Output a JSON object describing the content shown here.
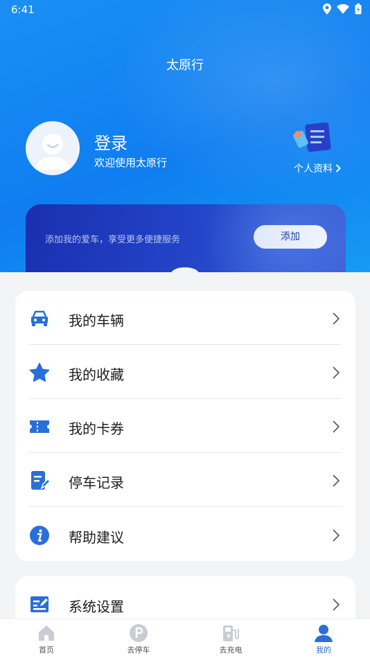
{
  "status_bar": {
    "time": "6:41"
  },
  "header": {
    "title": "太原行"
  },
  "user": {
    "login_label": "登录",
    "welcome": "欢迎使用太原行",
    "profile_link": "个人资料"
  },
  "car_card": {
    "hint": "添加我的爱车，享受更多便捷服务",
    "add_label": "添加"
  },
  "menu": [
    {
      "label": "我的车辆",
      "icon": "car-icon"
    },
    {
      "label": "我的收藏",
      "icon": "star-icon"
    },
    {
      "label": "我的卡券",
      "icon": "ticket-icon"
    },
    {
      "label": "停车记录",
      "icon": "record-icon"
    },
    {
      "label": "帮助建议",
      "icon": "info-icon"
    }
  ],
  "menu2": [
    {
      "label": "系统设置",
      "icon": "settings-icon"
    }
  ],
  "tabs": [
    {
      "label": "首页",
      "icon": "home-icon"
    },
    {
      "label": "去停车",
      "icon": "parking-icon"
    },
    {
      "label": "去充电",
      "icon": "charging-icon"
    },
    {
      "label": "我的",
      "icon": "user-icon"
    }
  ],
  "colors": {
    "accent": "#2a6fd8",
    "hero": "#1a8ff4"
  }
}
